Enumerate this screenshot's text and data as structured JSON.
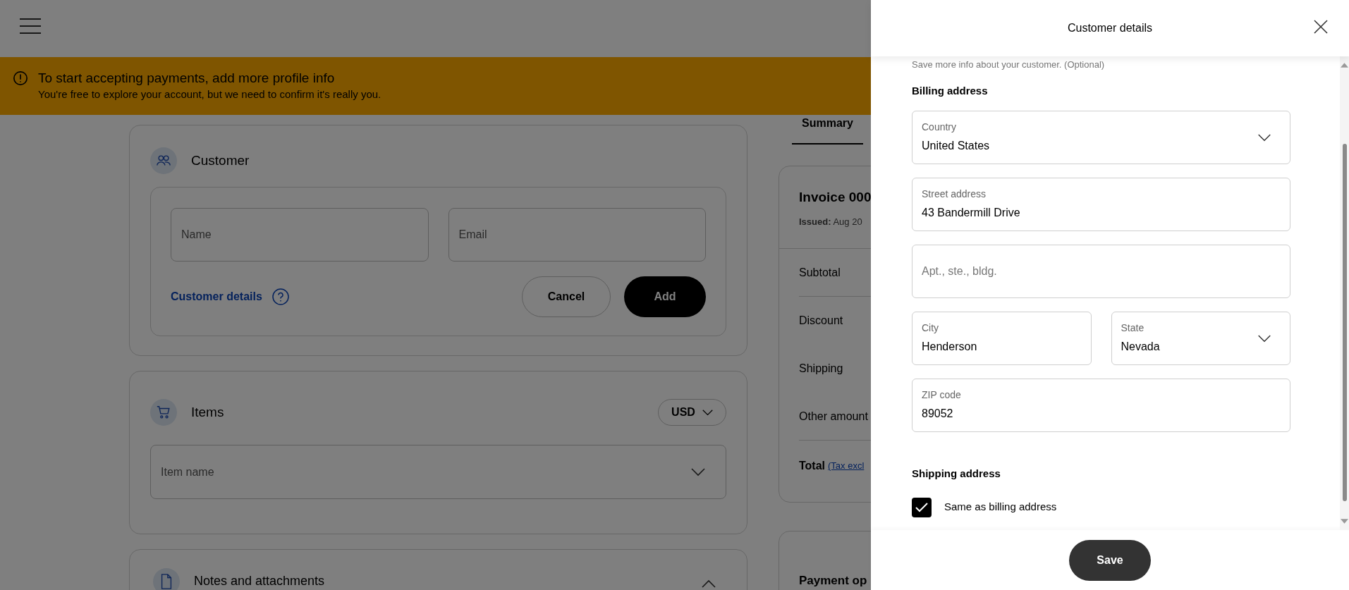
{
  "banner": {
    "title": "To start accepting payments, add more profile info",
    "message": "You're free to explore your account, but we need to confirm it's really you."
  },
  "customer_card": {
    "title": "Customer",
    "name_placeholder": "Name",
    "email_placeholder": "Email",
    "details_link": "Customer details",
    "cancel": "Cancel",
    "add": "Add"
  },
  "items_card": {
    "title": "Items",
    "currency": "USD",
    "item_placeholder": "Item name"
  },
  "notes_card": {
    "title": "Notes and attachments"
  },
  "summary": {
    "tabs": [
      {
        "label": "Summary",
        "selected": true
      }
    ],
    "invoice_title": "Invoice 000",
    "issued_label": "Issued:",
    "issued_value": "Aug 20",
    "rows": [
      {
        "label": "Subtotal",
        "divider": true
      },
      {
        "label": "Discount",
        "divider": false
      },
      {
        "label": "Shipping",
        "divider": false
      },
      {
        "label": "Other amount",
        "divider": true
      }
    ],
    "total_label": "Total",
    "tax_link": "(Tax excl",
    "payment_title": "Payment op"
  },
  "panel": {
    "title": "Customer details",
    "subtitle": "Save more info about your customer. (Optional)",
    "billing_title": "Billing address",
    "field_rows": [
      [
        {
          "kind": "select",
          "label": "Country",
          "value": "United States"
        }
      ],
      [
        {
          "kind": "text",
          "label": "Street address",
          "value": "43 Bandermill Drive"
        }
      ],
      [
        {
          "kind": "text",
          "placeholder": "Apt., ste., bldg."
        }
      ],
      [
        {
          "kind": "text",
          "label": "City",
          "value": "Henderson"
        },
        {
          "kind": "select",
          "label": "State",
          "value": "Nevada"
        }
      ],
      [
        {
          "kind": "text",
          "label": "ZIP code",
          "value": "89052"
        }
      ]
    ],
    "shipping_title": "Shipping address",
    "same_as_billing": {
      "label": "Same as billing address",
      "checked": true
    },
    "save": "Save"
  }
}
